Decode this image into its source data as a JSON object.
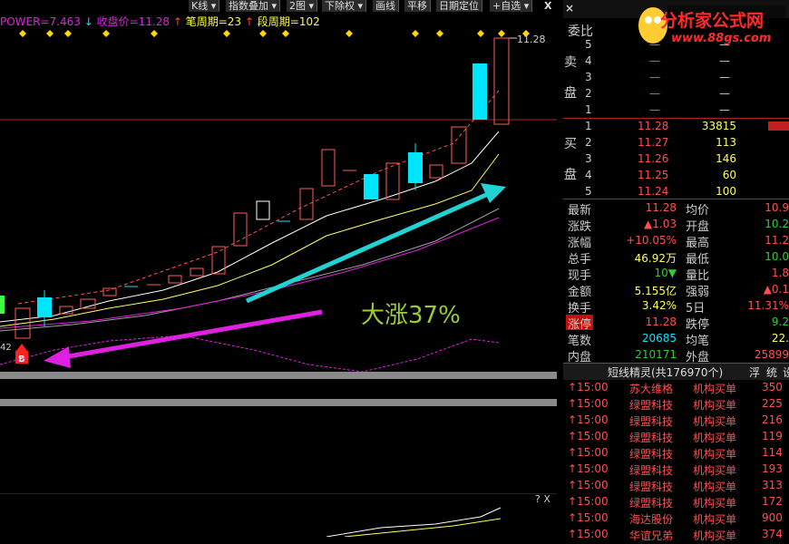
{
  "toolbar": {
    "items": [
      "K线",
      "指数叠加",
      "2图",
      "下除权",
      "画线",
      "平移",
      "日期定位",
      "自选"
    ],
    "close_glyph": "X"
  },
  "legend": {
    "power": "POWER=7.463",
    "close": "收盘价=11.28",
    "bi": "笔周期=23",
    "duan": "段周期=102"
  },
  "chart": {
    "price_label": "11.28",
    "annotation": "大涨37%",
    "b_marker": "B",
    "partial_label": "42",
    "help": "? X",
    "accent_cyan": "#22d3d3",
    "accent_magenta": "#e020e0",
    "candle_up": "#ff5a5a",
    "candle_down": "#00e5ff"
  },
  "logo": {
    "title": "分析家公式网",
    "url": "www.88gs.com"
  },
  "orderbook": {
    "webi_label": "委比",
    "sell_label": [
      "卖",
      "盘"
    ],
    "buy_label": [
      "买",
      "盘"
    ],
    "sell": [
      {
        "lvl": "5",
        "price": "—",
        "vol": "—"
      },
      {
        "lvl": "4",
        "price": "—",
        "vol": "—"
      },
      {
        "lvl": "3",
        "price": "—",
        "vol": "—"
      },
      {
        "lvl": "2",
        "price": "—",
        "vol": "—"
      },
      {
        "lvl": "1",
        "price": "—",
        "vol": "—"
      }
    ],
    "buy": [
      {
        "lvl": "1",
        "price": "11.28",
        "vol": "33815"
      },
      {
        "lvl": "2",
        "price": "11.27",
        "vol": "113"
      },
      {
        "lvl": "3",
        "price": "11.26",
        "vol": "146"
      },
      {
        "lvl": "4",
        "price": "11.25",
        "vol": "60"
      },
      {
        "lvl": "5",
        "price": "11.24",
        "vol": "100"
      }
    ]
  },
  "stats": [
    {
      "l": "最新",
      "v": "11.28",
      "l2": "均价",
      "v2": "10.9"
    },
    {
      "l": "涨跌",
      "v": "▲1.03",
      "l2": "开盘",
      "v2": "10.2"
    },
    {
      "l": "涨幅",
      "v": "+10.05%",
      "l2": "最高",
      "v2": "11.2"
    },
    {
      "l": "总手",
      "v": "46.92万",
      "l2": "最低",
      "v2": "10.0"
    },
    {
      "l": "现手",
      "v": "10▼",
      "l2": "量比",
      "v2": "1.8"
    },
    {
      "l": "金额",
      "v": "5.155亿",
      "l2": "强弱",
      "v2": "▲0.1"
    },
    {
      "l": "换手",
      "v": "3.42%",
      "l2": "5日",
      "v2": "11.31%"
    },
    {
      "l": "涨停",
      "v": "11.28",
      "l2": "跌停",
      "v2": "9.2"
    },
    {
      "l": "笔数",
      "v": "20685",
      "l2": "均笔",
      "v2": "22."
    },
    {
      "l": "内盘",
      "v": "210171",
      "l2": "外盘",
      "v2": "25899"
    }
  ],
  "tape": {
    "header": "短线精灵(共176970个)",
    "tab1": "浮",
    "tab2": "统",
    "tab3": "设",
    "rows": [
      {
        "t": "15:00",
        "name": "苏大维格",
        "act": "机构买单",
        "n": "350"
      },
      {
        "t": "15:00",
        "name": "绿盟科技",
        "act": "机构买单",
        "n": "225"
      },
      {
        "t": "15:00",
        "name": "绿盟科技",
        "act": "机构买单",
        "n": "216"
      },
      {
        "t": "15:00",
        "name": "绿盟科技",
        "act": "机构买单",
        "n": "119"
      },
      {
        "t": "15:00",
        "name": "绿盟科技",
        "act": "机构买单",
        "n": "114"
      },
      {
        "t": "15:00",
        "name": "绿盟科技",
        "act": "机构买单",
        "n": "193"
      },
      {
        "t": "15:00",
        "name": "绿盟科技",
        "act": "机构买单",
        "n": "313"
      },
      {
        "t": "15:00",
        "name": "绿盟科技",
        "act": "机构买单",
        "n": "172"
      },
      {
        "t": "15:00",
        "name": "海达股份",
        "act": "机构买单",
        "n": "900"
      },
      {
        "t": "15:00",
        "name": "华谊兄弟",
        "act": "机构买单",
        "n": "374"
      }
    ]
  }
}
